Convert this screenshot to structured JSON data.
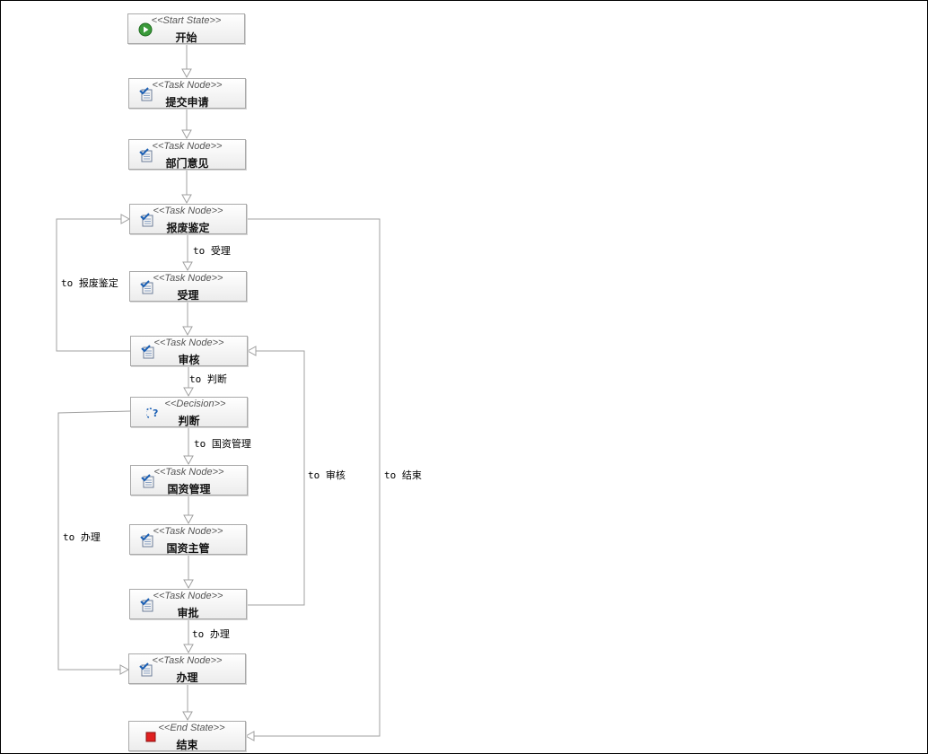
{
  "nodes": {
    "start": {
      "stereotype": "<<Start State>>",
      "name": "开始"
    },
    "submit": {
      "stereotype": "<<Task Node>>",
      "name": "提交申请"
    },
    "dept": {
      "stereotype": "<<Task Node>>",
      "name": "部门意见"
    },
    "scrap": {
      "stereotype": "<<Task Node>>",
      "name": "报废鉴定"
    },
    "accept": {
      "stereotype": "<<Task Node>>",
      "name": "受理"
    },
    "review": {
      "stereotype": "<<Task Node>>",
      "name": "审核"
    },
    "decide": {
      "stereotype": "<<Decision>>",
      "name": "判断"
    },
    "assets": {
      "stereotype": "<<Task Node>>",
      "name": "国资管理"
    },
    "supervisor": {
      "stereotype": "<<Task Node>>",
      "name": "国资主管"
    },
    "approve": {
      "stereotype": "<<Task Node>>",
      "name": "审批"
    },
    "handle": {
      "stereotype": "<<Task Node>>",
      "name": "办理"
    },
    "end": {
      "stereotype": "<<End State>>",
      "name": "结束"
    }
  },
  "transitions": {
    "to_accept": "to 受理",
    "to_scrap": "to 报废鉴定",
    "to_decide": "to 判断",
    "to_assets": "to 国资管理",
    "to_review": "to 审核",
    "to_end": "to 结束",
    "to_handle_left": "to 办理",
    "to_handle": "to 办理"
  },
  "icons": {
    "start": "start-state-icon",
    "task": "task-node-icon",
    "decision": "decision-icon",
    "end": "end-state-icon"
  }
}
